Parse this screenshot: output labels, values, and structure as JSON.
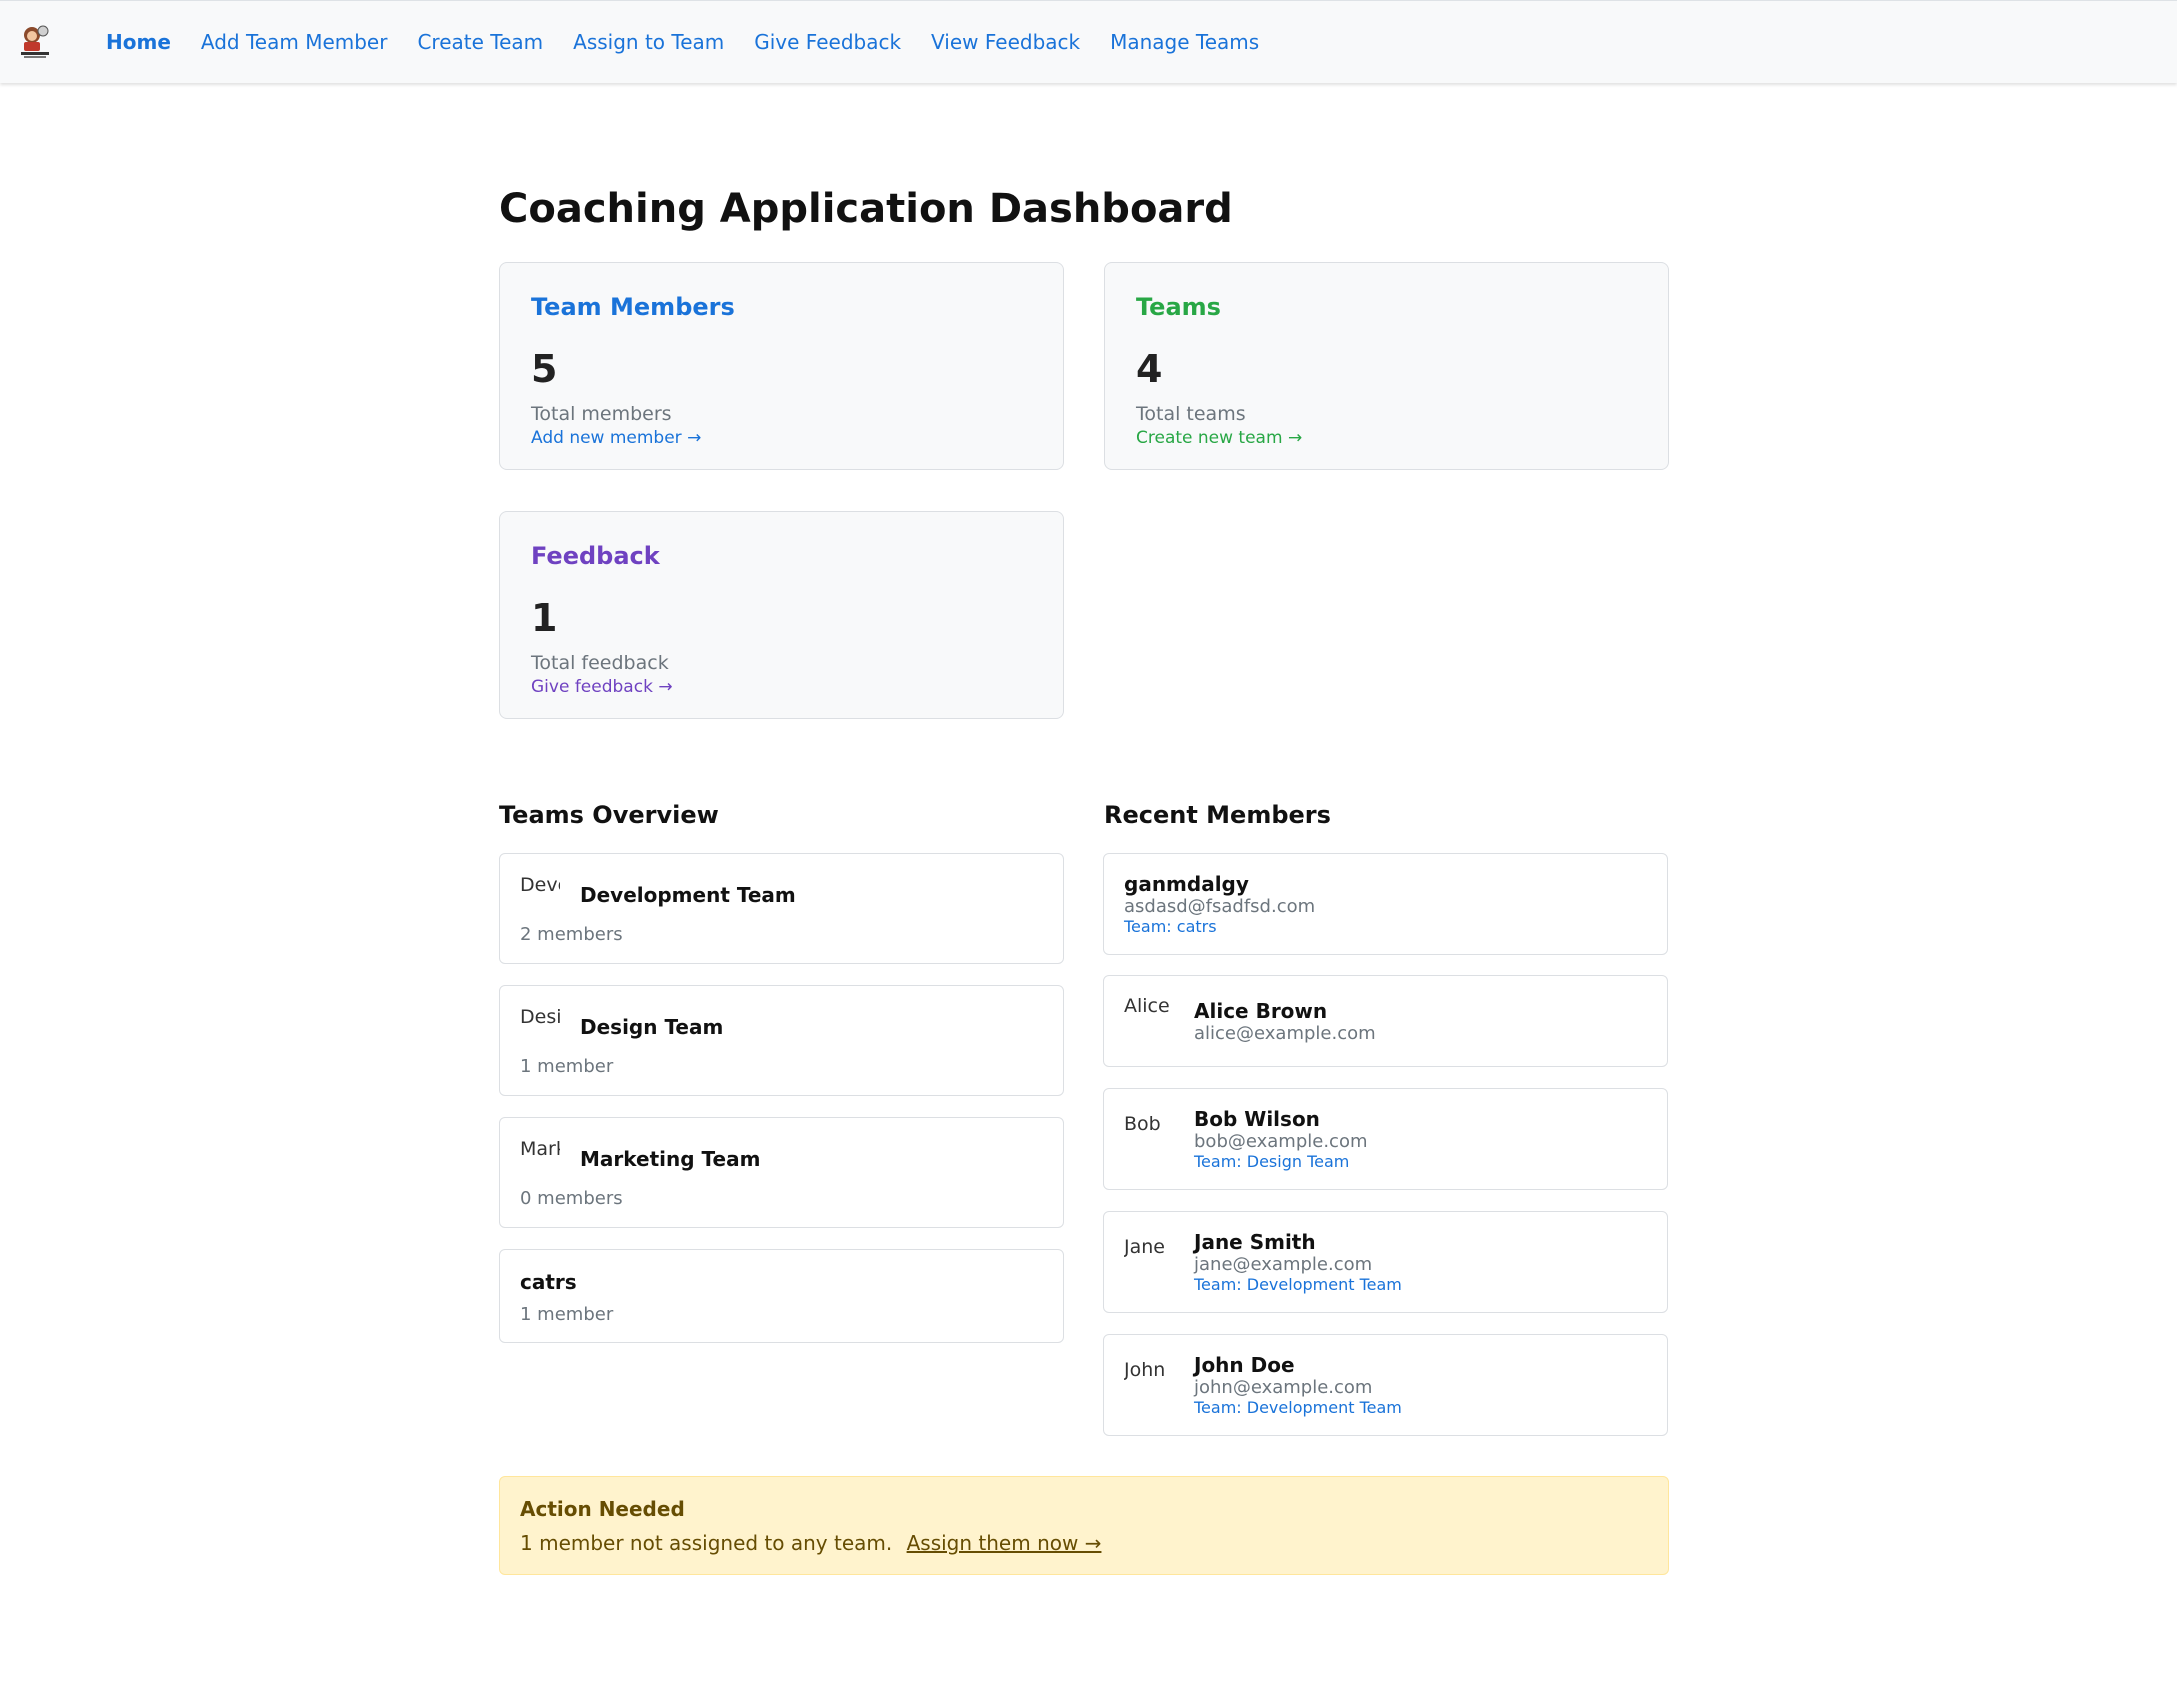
{
  "nav": {
    "links": [
      {
        "label": "Home",
        "active": true
      },
      {
        "label": "Add Team Member"
      },
      {
        "label": "Create Team"
      },
      {
        "label": "Assign to Team"
      },
      {
        "label": "Give Feedback"
      },
      {
        "label": "View Feedback"
      },
      {
        "label": "Manage Teams"
      }
    ]
  },
  "page_title": "Coaching Application Dashboard",
  "stats": {
    "members": {
      "title": "Team Members",
      "value": "5",
      "desc": "Total members",
      "link": "Add new member →",
      "color": "#1a73d9"
    },
    "teams": {
      "title": "Teams",
      "value": "4",
      "desc": "Total teams",
      "link": "Create new team →",
      "color": "#28a745"
    },
    "feedback": {
      "title": "Feedback",
      "value": "1",
      "desc": "Total feedback",
      "link": "Give feedback →",
      "color": "#6f42c1"
    }
  },
  "teams_overview": {
    "title": "Teams Overview",
    "teams": [
      {
        "img_alt": "Deve",
        "name": "Development Team",
        "count": "2 members"
      },
      {
        "img_alt": "Desi",
        "name": "Design Team",
        "count": "1 member"
      },
      {
        "img_alt": "Mark",
        "name": "Marketing Team",
        "count": "0 members"
      },
      {
        "name": "catrs",
        "count": "1 member"
      }
    ]
  },
  "recent_members": {
    "title": "Recent Members",
    "members": [
      {
        "name": "ganmdalgy",
        "email": "asdasd@fsadfsd.com",
        "team": "Team: catrs"
      },
      {
        "img_alt": "Alice",
        "name": "Alice Brown",
        "email": "alice@example.com"
      },
      {
        "img_alt": "Bob",
        "name": "Bob Wilson",
        "email": "bob@example.com",
        "team": "Team: Design Team"
      },
      {
        "img_alt": "Jane",
        "name": "Jane Smith",
        "email": "jane@example.com",
        "team": "Team: Development Team"
      },
      {
        "img_alt": "John",
        "name": "John Doe",
        "email": "john@example.com",
        "team": "Team: Development Team"
      }
    ]
  },
  "alert": {
    "title": "Action Needed",
    "text": "1 member not assigned to any team.",
    "link": "Assign them now →"
  }
}
